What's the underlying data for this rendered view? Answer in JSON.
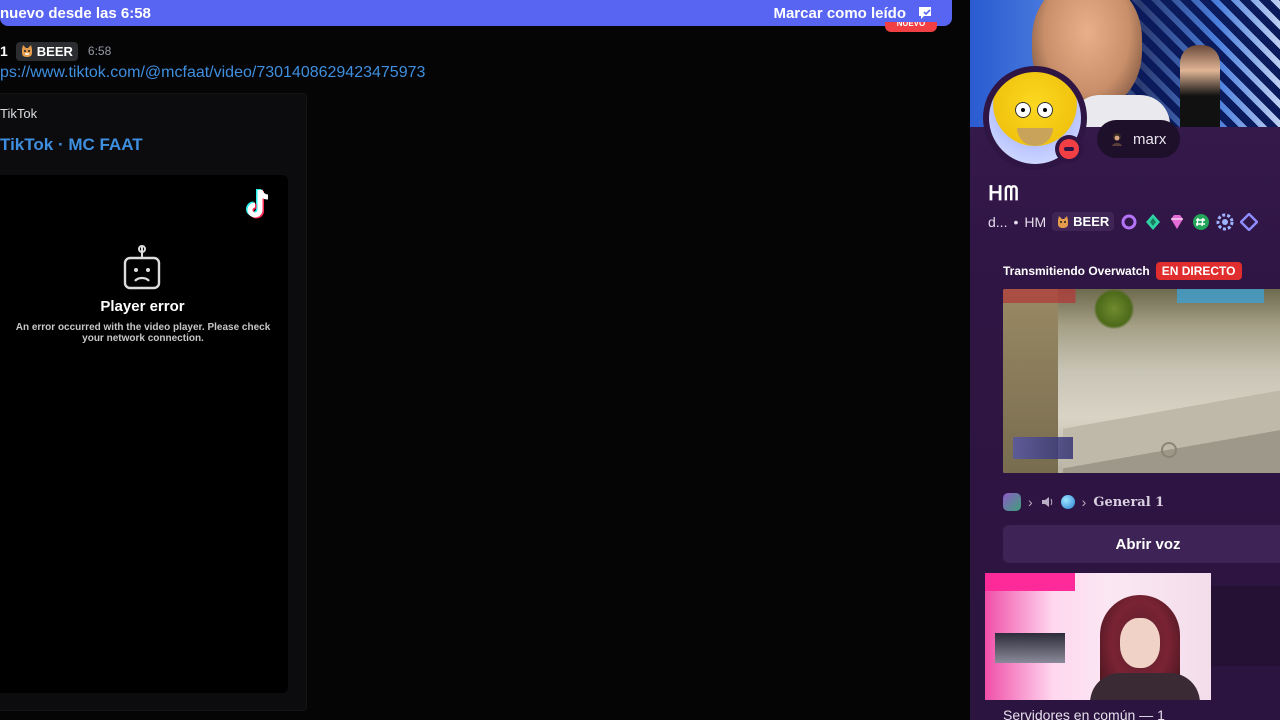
{
  "chat": {
    "new_messages_bar": {
      "text": "nuevo desde las 6:58",
      "mark_read": "Marcar como leído",
      "new_pill": "NUEVO",
      "color": "#5865f2"
    },
    "message": {
      "author_fragment": "1",
      "tag": "BEER",
      "timestamp": "6:58",
      "link": "ps://www.tiktok.com/@mcfaat/video/7301408629423475973",
      "embed": {
        "provider": "TikTok",
        "title": "TikTok · MC FAAT",
        "player_error_title": "Player error",
        "player_error_text": "An error occurred with the video player. Please check your network connection."
      }
    }
  },
  "profile": {
    "custom_status": "marx",
    "display_name": "ᕼᗰ",
    "meta": {
      "username": "d...",
      "separator": "•",
      "pronouns": "HM",
      "tag": "BEER"
    },
    "status_color": "#f23f43",
    "activity": {
      "label": "Transmitiendo Overwatch",
      "live_badge": "EN DIRECTO",
      "voice_channel": "General 1",
      "open_voice_button": "Abrir voz"
    },
    "mutual_servers": "Servidores en común — 1"
  }
}
